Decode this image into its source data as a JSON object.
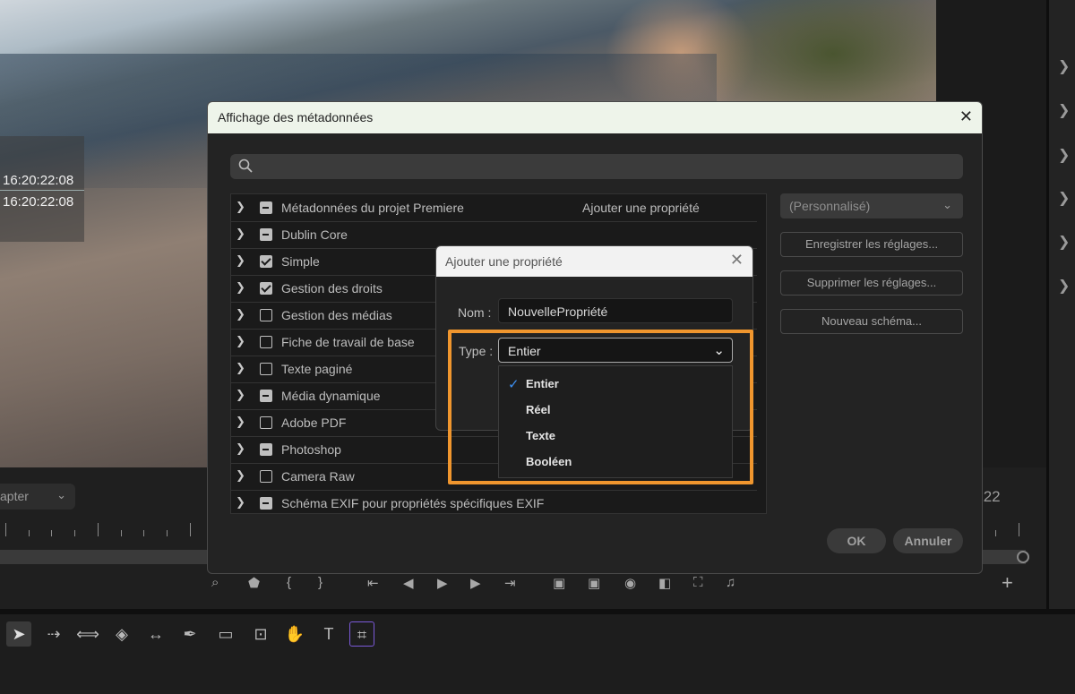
{
  "video": {
    "timecode_1": "16:20:22:08",
    "timecode_2": "16:20:22:08"
  },
  "monitor": {
    "chapter_dropdown": "apter",
    "timecode_right": ":22"
  },
  "dialog": {
    "title": "Affichage des métadonnées",
    "search_placeholder": "",
    "rows": [
      {
        "label": "Métadonnées du projet Premiere",
        "state": "mixed",
        "action": "Ajouter une propriété"
      },
      {
        "label": "Dublin Core",
        "state": "mixed"
      },
      {
        "label": "Simple",
        "state": "checked"
      },
      {
        "label": "Gestion des droits",
        "state": "checked"
      },
      {
        "label": "Gestion des médias",
        "state": "unchecked"
      },
      {
        "label": "Fiche de travail de base",
        "state": "unchecked"
      },
      {
        "label": "Texte paginé",
        "state": "unchecked"
      },
      {
        "label": "Média dynamique",
        "state": "mixed"
      },
      {
        "label": "Adobe PDF",
        "state": "unchecked"
      },
      {
        "label": "Photoshop",
        "state": "mixed"
      },
      {
        "label": "Camera Raw",
        "state": "unchecked"
      },
      {
        "label": "Schéma EXIF pour propriétés spécifiques EXIF",
        "state": "mixed"
      }
    ],
    "preset": "(Personnalisé)",
    "save_settings": "Enregistrer les réglages...",
    "delete_settings": "Supprimer les réglages...",
    "new_schema": "Nouveau schéma...",
    "ok": "OK",
    "cancel": "Annuler"
  },
  "add_property": {
    "title": "Ajouter une propriété",
    "name_label": "Nom :",
    "name_value": "NouvellePropriété",
    "type_label": "Type :",
    "type_value": "Entier",
    "options": [
      "Entier",
      "Réel",
      "Texte",
      "Booléen"
    ],
    "selected_option": "Entier"
  },
  "colors": {
    "highlight": "#f0962e",
    "check_accent": "#3d8ff0",
    "tool_active_border": "#7b5ad9"
  }
}
